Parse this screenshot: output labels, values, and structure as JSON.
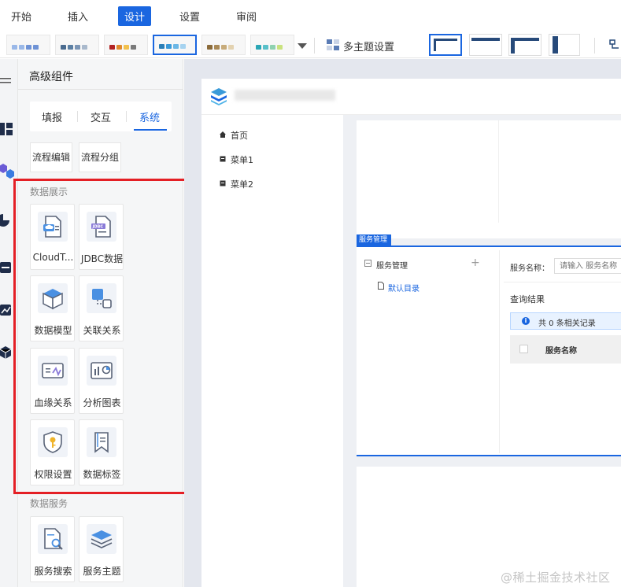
{
  "menu": {
    "items": [
      {
        "label": "开始",
        "active": false
      },
      {
        "label": "插入",
        "active": false
      },
      {
        "label": "设计",
        "active": true
      },
      {
        "label": "设置",
        "active": false
      },
      {
        "label": "审阅",
        "active": false
      }
    ]
  },
  "toolbar": {
    "theme_swatches": [
      {
        "colors": [
          "#9ab8e8",
          "#9ab8e8",
          "#6f93d6",
          "#6f93d6"
        ],
        "selected": false
      },
      {
        "colors": [
          "#4a6b8f",
          "#5b7fa3",
          "#7b95b5",
          "#a9b9cc"
        ],
        "selected": false
      },
      {
        "colors": [
          "#b22222",
          "#e08a2c",
          "#f2c14e",
          "#7a7a7a"
        ],
        "selected": false
      },
      {
        "colors": [
          "#2a7fb8",
          "#3a9ad9",
          "#6bb7e6",
          "#a6d3f0"
        ],
        "selected": true
      },
      {
        "colors": [
          "#8b6b3a",
          "#a98957",
          "#c7ab7a",
          "#e3d2b0"
        ],
        "selected": false
      },
      {
        "colors": [
          "#2aa6b5",
          "#58c0c9",
          "#8fd2b0",
          "#c9e27e"
        ],
        "selected": false
      }
    ],
    "more_label": "多主题设置",
    "layout_icon_color": "#274a7a"
  },
  "panel": {
    "title": "高级组件",
    "tabs": [
      {
        "label": "填报",
        "active": false
      },
      {
        "label": "交互",
        "active": false
      },
      {
        "label": "系统",
        "active": true
      }
    ],
    "process_chips": [
      "流程编辑",
      "流程分组"
    ],
    "sections": [
      {
        "label": "数据展示",
        "cards": [
          {
            "label": "CloudT...",
            "icon": "cloud-table-icon"
          },
          {
            "label": "JDBC数据",
            "icon": "jdbc-file-icon"
          },
          {
            "label": "数据模型",
            "icon": "cube-icon"
          },
          {
            "label": "关联关系",
            "icon": "relation-icon"
          },
          {
            "label": "血缘关系",
            "icon": "lineage-icon"
          },
          {
            "label": "分析图表",
            "icon": "analysis-chart-icon"
          },
          {
            "label": "权限设置",
            "icon": "shield-key-icon"
          },
          {
            "label": "数据标签",
            "icon": "bookmark-icon"
          }
        ]
      },
      {
        "label": "数据服务",
        "cards": [
          {
            "label": "服务搜索",
            "icon": "doc-search-icon"
          },
          {
            "label": "服务主题",
            "icon": "layers-icon"
          }
        ]
      }
    ]
  },
  "app": {
    "nav": [
      "首页",
      "菜单1",
      "菜单2"
    ],
    "service_tag": "服务管理",
    "tree": {
      "root": "服务管理",
      "add": "+",
      "leaf": "默认目录"
    },
    "search": {
      "label": "服务名称：",
      "placeholder": "请输入 服务名称"
    },
    "result_title": "查询结果",
    "info_icon": "i",
    "info_text": "共 0 条相关记录",
    "table_column": "服务名称"
  },
  "highlight_color": "#e41f25",
  "accent_color": "#1a66e0",
  "watermark": "@稀土掘金技术社区"
}
